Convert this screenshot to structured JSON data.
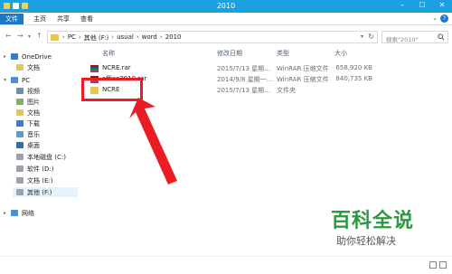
{
  "window": {
    "title": "2010",
    "controls": [
      "–",
      "☐",
      "✕"
    ]
  },
  "ribbon": {
    "tabs": [
      "文件",
      "主页",
      "共享",
      "查看"
    ],
    "expand_icon": "chevron-down-icon",
    "help_icon": "?"
  },
  "nav": {
    "back_icon": "←",
    "forward_icon": "→",
    "recent_icon": "▾",
    "up_icon": "↑",
    "breadcrumb": [
      "PC",
      "其他 (F:)",
      "usual",
      "word",
      "2010"
    ],
    "search_placeholder": "搜索\"2010\""
  },
  "sidebar": [
    {
      "label": "OneDrive",
      "icon": "cloud-icon"
    },
    {
      "label": "文档",
      "icon": "folder-icon"
    },
    {
      "label": "PC",
      "icon": "computer-icon"
    },
    {
      "label": "视频",
      "icon": "video-icon"
    },
    {
      "label": "图片",
      "icon": "image-icon"
    },
    {
      "label": "文档",
      "icon": "folder-icon"
    },
    {
      "label": "下载",
      "icon": "download-icon"
    },
    {
      "label": "音乐",
      "icon": "music-icon"
    },
    {
      "label": "桌面",
      "icon": "desktop-icon"
    },
    {
      "label": "本地磁盘 (C:)",
      "icon": "drive-icon"
    },
    {
      "label": "软件 (D:)",
      "icon": "drive-icon"
    },
    {
      "label": "文档 (E:)",
      "icon": "drive-icon"
    },
    {
      "label": "其他 (F:)",
      "icon": "drive-icon"
    },
    {
      "label": "网络",
      "icon": "network-icon"
    }
  ],
  "files": {
    "columns": [
      "名称",
      "修改日期",
      "类型",
      "大小"
    ],
    "rows": [
      {
        "name": "NCRE.rar",
        "date": "2015/7/13 星期...",
        "type": "WinRAR 压缩文件",
        "size": "658,920 KB",
        "icon": "rar-icon"
      },
      {
        "name": "office2010.rar",
        "date": "2014/9/8 星期一...",
        "type": "WinRAR 压缩文件",
        "size": "840,735 KB",
        "icon": "rar-icon"
      },
      {
        "name": "NCRE",
        "date": "2015/7/13 星期...",
        "type": "文件夹",
        "size": "",
        "icon": "folder-icon"
      }
    ]
  },
  "watermark": {
    "title": "百科全说",
    "subtitle": "助你轻松解决"
  },
  "colors": {
    "title_bar": "#1ba1e2",
    "file_tab": "#1979ca",
    "highlight": "#ec1c24",
    "watermark": "#2b9a3d"
  }
}
